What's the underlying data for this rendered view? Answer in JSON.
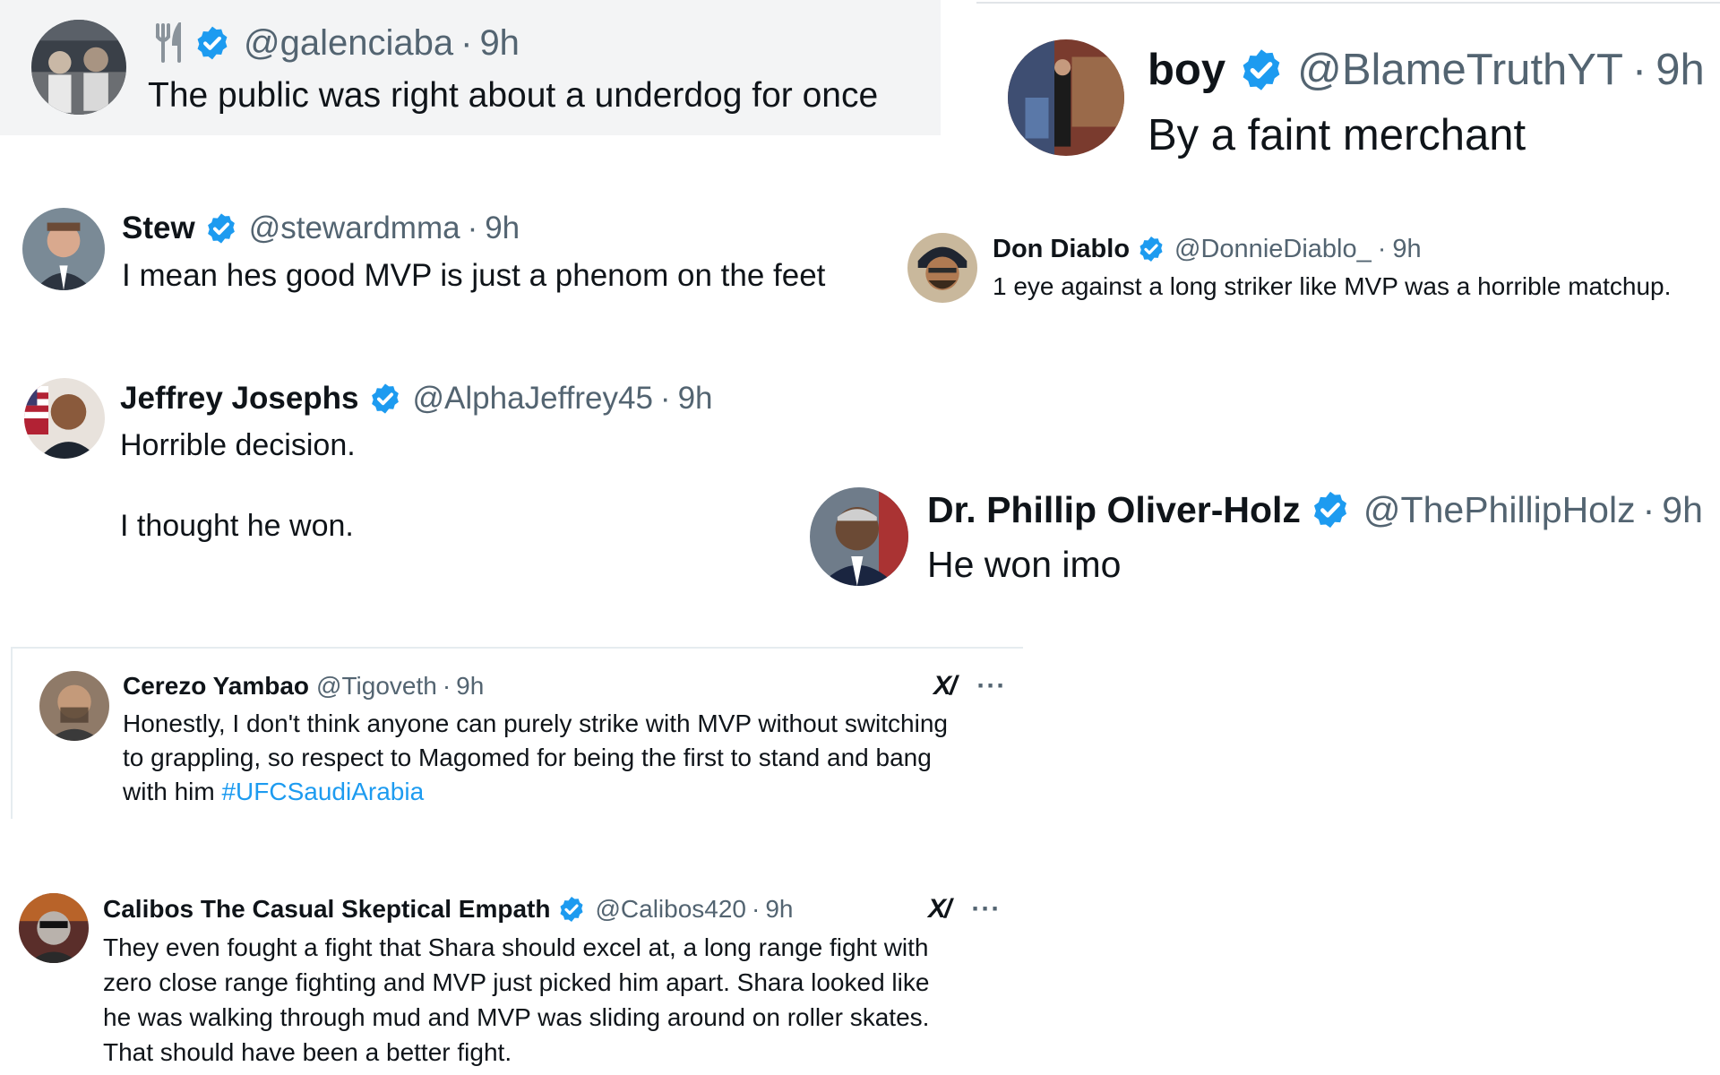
{
  "colors": {
    "verified_badge": "#1d9bf0",
    "handle_gray": "#536471",
    "text_dark": "#0f1419",
    "hashtag_blue": "#1d9bf0",
    "panel_gray": "#f3f4f5"
  },
  "tweets": [
    {
      "id": "galenciaba",
      "display_name": "",
      "icon": "fork-knife-icon",
      "verified": true,
      "handle": "@galenciaba",
      "separator": "·",
      "time": "9h",
      "text": "The public was right about a underdog for once"
    },
    {
      "id": "blametruth",
      "display_name": "boy",
      "verified": true,
      "handle": "@BlameTruthYT",
      "separator": "·",
      "time": "9h",
      "text": "By a faint merchant"
    },
    {
      "id": "stew",
      "display_name": "Stew",
      "verified": true,
      "handle": "@stewardmma",
      "separator": "·",
      "time": "9h",
      "text": "I mean hes good MVP is just a phenom on the feet"
    },
    {
      "id": "dondiablo",
      "display_name": "Don Diablo",
      "verified": true,
      "handle": "@DonnieDiablo_",
      "separator": "·",
      "time": "9h",
      "text": "1 eye against a long striker like MVP was a horrible matchup."
    },
    {
      "id": "jeffrey",
      "display_name": "Jeffrey Josephs",
      "verified": true,
      "handle": "@AlphaJeffrey45",
      "separator": "·",
      "time": "9h",
      "text_line1": "Horrible decision.",
      "text_line2": "I thought he won."
    },
    {
      "id": "phillip",
      "display_name": "Dr. Phillip Oliver-Holz",
      "verified": true,
      "handle": "@ThePhillipHolz",
      "separator": "·",
      "time": "9h",
      "text": "He won imo"
    },
    {
      "id": "cerezo",
      "display_name": "Cerezo Yambao",
      "verified": false,
      "handle": "@Tigoveth",
      "separator": "·",
      "time": "9h",
      "text_line1": "Honestly, I don't think anyone can purely strike with MVP without switching",
      "text_line2": "to grappling, so respect to Magomed for being the first to stand and bang",
      "text_line3_prefix": "with him ",
      "hashtag": "#UFCSaudiArabia",
      "grok_icon": "xai-grok-icon",
      "grok_glyph": "X/",
      "more_glyph": "···"
    },
    {
      "id": "calibos",
      "display_name": "Calibos The Casual Skeptical Empath",
      "verified": true,
      "handle": "@Calibos420",
      "separator": "·",
      "time": "9h",
      "text_line1": "They even fought a fight that Shara should excel at, a long range fight with",
      "text_line2": "zero close range fighting and MVP just picked him apart. Shara looked like",
      "text_line3": "he was walking through mud and MVP was sliding around on roller skates.",
      "text_line4": "That should have been a better fight.",
      "grok_icon": "xai-grok-icon",
      "grok_glyph": "X/",
      "more_glyph": "···"
    }
  ]
}
